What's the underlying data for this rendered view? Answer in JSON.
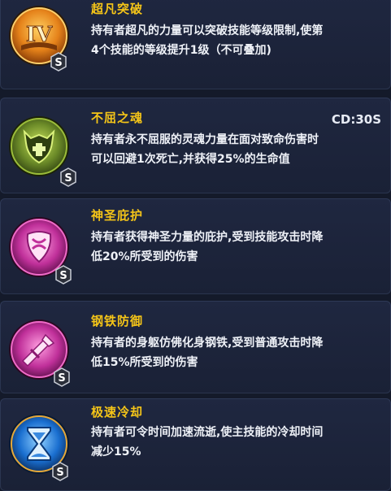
{
  "skills": [
    {
      "name": "超凡突破",
      "desc_lines": [
        "持有者超凡的力量可以突破技能等级限制,使第",
        "4个技能的等级提升1级（不可叠加)"
      ],
      "icon": "book-roman-four-icon",
      "badge": "S",
      "roman": "IV",
      "accent": "#e58a1a"
    },
    {
      "name": "不屈之魂",
      "cooldown": "CD:30S",
      "desc_lines": [
        "持有者永不屈服的灵魂力量在面对致命伤害时",
        "可以回避1次死亡,并获得25%的生命值"
      ],
      "icon": "demon-shield-icon",
      "badge": "S",
      "accent": "#6b8a28"
    },
    {
      "name": "神圣庇护",
      "desc_lines": [
        "持有者获得神圣力量的庇护,受到技能攻击时降",
        "低20%所受到的伤害"
      ],
      "icon": "holy-shield-icon",
      "badge": "S",
      "accent": "#c0309a"
    },
    {
      "name": "钢铁防御",
      "desc_lines": [
        "持有者的身躯仿佛化身钢铁,受到普通攻击时降",
        "低15%所受到的伤害"
      ],
      "icon": "broken-sword-icon",
      "badge": "S",
      "accent": "#c0309a"
    },
    {
      "name": "极速冷却",
      "desc_lines": [
        "持有者可令时间加速流逝,使主技能的冷却时间",
        "减少15%"
      ],
      "icon": "hourglass-icon",
      "badge": "S",
      "accent": "#1a6fd0"
    }
  ]
}
